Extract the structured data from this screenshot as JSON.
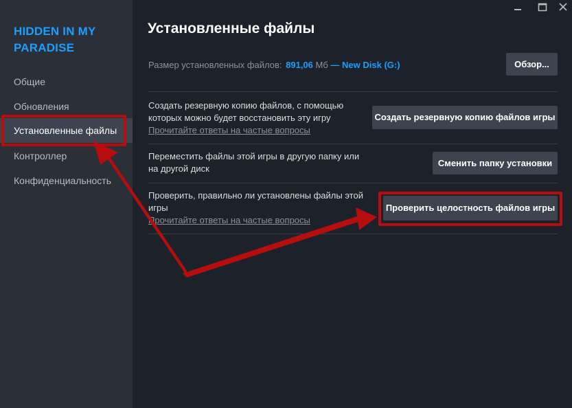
{
  "sidebar": {
    "game_title": "HIDDEN IN MY PARADISE",
    "items": [
      {
        "label": "Общие"
      },
      {
        "label": "Обновления"
      },
      {
        "label": "Установленные файлы"
      },
      {
        "label": "Контроллер"
      },
      {
        "label": "Конфиденциальность"
      }
    ],
    "active_index": 2
  },
  "window": {
    "minimize_icon": "minimize-icon",
    "maximize_icon": "maximize-icon",
    "close_icon": "close-icon"
  },
  "main": {
    "title": "Установленные файлы",
    "size_label": "Размер установленных файлов:",
    "size_value": "891,06",
    "size_unit": "Мб",
    "size_sep": "—",
    "disk": "New Disk (G:)",
    "browse_button": "Обзор...",
    "rows": [
      {
        "description": "Создать резервную копию файлов, с помощью которых можно будет восстановить эту игру",
        "link": "Прочитайте ответы на частые вопросы",
        "button": "Создать резервную копию файлов игры"
      },
      {
        "description": "Переместить файлы этой игры в другую папку или на другой диск",
        "button": "Сменить папку установки"
      },
      {
        "description": "Проверить, правильно ли установлены файлы этой игры",
        "link": "Прочитайте ответы на частые вопросы",
        "button": "Проверить целостность файлов игры"
      }
    ]
  },
  "colors": {
    "accent": "#1a9fff",
    "annotation": "#b60d0f",
    "sidebar_bg": "#2a2f38",
    "main_bg": "#1c212a",
    "button_bg": "#3d4450"
  }
}
